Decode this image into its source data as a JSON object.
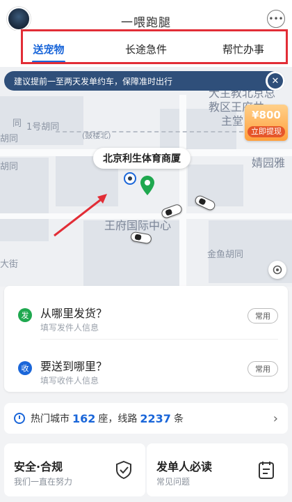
{
  "header": {
    "app_title": "一喂跑腿",
    "more_icon": "more-dots-icon"
  },
  "tabs": [
    {
      "label": "送宠物",
      "active": true
    },
    {
      "label": "长途急件",
      "active": false
    },
    {
      "label": "帮忙办事",
      "active": false
    }
  ],
  "notice": {
    "text": "建议提前一至两天发单约车，保障准时出行"
  },
  "reward": {
    "amount": "¥800",
    "button_label": "立即提现"
  },
  "map": {
    "place_name": "北京利生体育商厦",
    "labels": {
      "edu_district": "大主教北京总",
      "edu_district2": "教区王府井",
      "edu_district3": "主堂",
      "hutong1": "1号胡同",
      "jingyuan": "婧园雅",
      "wangfu_center": "王府国际中心",
      "jinyu_hutong": "金鱼胡同",
      "dajie": "大街",
      "bian": "(鼓楼北)",
      "left_top": "同",
      "left_mid": "胡同"
    }
  },
  "addresses": [
    {
      "badge": "发",
      "title": "从哪里发货？",
      "placeholder": "填写发件人信息",
      "button": "常用",
      "color": "#1fa84f"
    },
    {
      "badge": "收",
      "title": "要送到哪里？",
      "placeholder": "填写收件人信息",
      "button": "常用",
      "color": "#1a66d9"
    }
  ],
  "city_strip": {
    "prefix": "热门城市",
    "city_count": "162",
    "mid": "座，线路",
    "route_count": "2237",
    "suffix": "条"
  },
  "info_cards": [
    {
      "title": "安全·合规",
      "subtitle": "我们一直在努力",
      "icon": "shield-check-icon"
    },
    {
      "title": "发单人必读",
      "subtitle": "常见问题",
      "icon": "document-list-icon"
    }
  ],
  "colors": {
    "accent": "#1a66d9",
    "highlight_box": "#e22d36",
    "send_badge": "#1fa84f",
    "receive_badge": "#1a66d9"
  }
}
